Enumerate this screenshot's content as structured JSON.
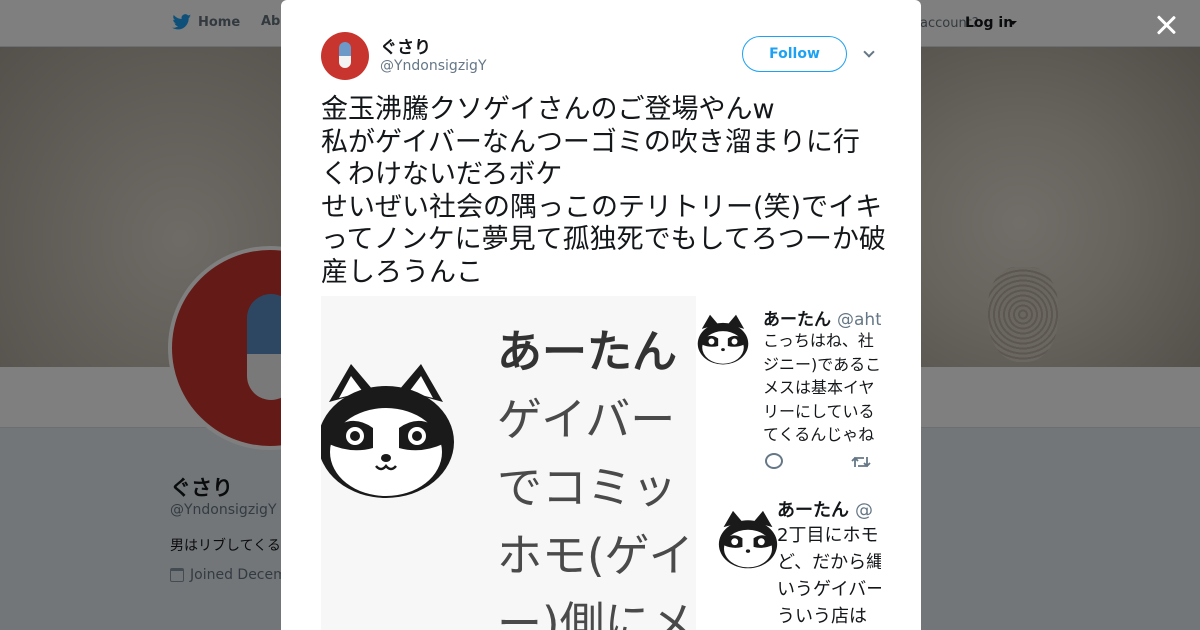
{
  "background": {
    "nav": {
      "home": "Home",
      "about": "Abo",
      "account_question": "account?",
      "login": "Log in"
    },
    "profile": {
      "name": "ぐさり",
      "handle": "@YndonsigzigY",
      "bio": "男はリブしてくる",
      "joined": "Joined Decem"
    }
  },
  "modal": {
    "author_name": "ぐさり",
    "author_handle": "@YndonsigzigY",
    "follow_label": "Follow",
    "tweet_text": "金玉沸騰クソゲイさんのご登場やんw\n私がゲイバーなんつーゴミの吹き溜まりに行くわけないだろボケ\nせいぜい社会の隅っこのテリトリー(笑)でイキってノンケに夢見て孤独死でもしてろつーか破産しろうんこ",
    "media": {
      "left_lines": [
        "あーたん",
        "ゲイバー",
        "でコミッ",
        "ホモ(ゲイ",
        "ー)側にメ"
      ],
      "quote1": {
        "name": "あーたん",
        "handle": "@ahta",
        "lines": [
          "こっちはね、社",
          "ジニー)であるこ",
          "メスは基本イヤ",
          "リーにしている",
          "てくるんじゃね"
        ]
      },
      "quote2": {
        "name": "あーたん",
        "handle": "@",
        "lines": [
          "2丁目にホモ",
          "ど、だから縄",
          "いうゲイバー",
          "ういう店は"
        ]
      }
    }
  },
  "icons": [
    "twitter-bird-icon",
    "calendar-icon",
    "close-icon",
    "chevron-down-icon",
    "reply-icon",
    "retweet-icon",
    "raccoon-avatar-icon"
  ],
  "colors": {
    "twitter_blue": "#1da1f2",
    "avatar_red": "#c8352e",
    "text": "#14171a",
    "muted": "#657786"
  }
}
